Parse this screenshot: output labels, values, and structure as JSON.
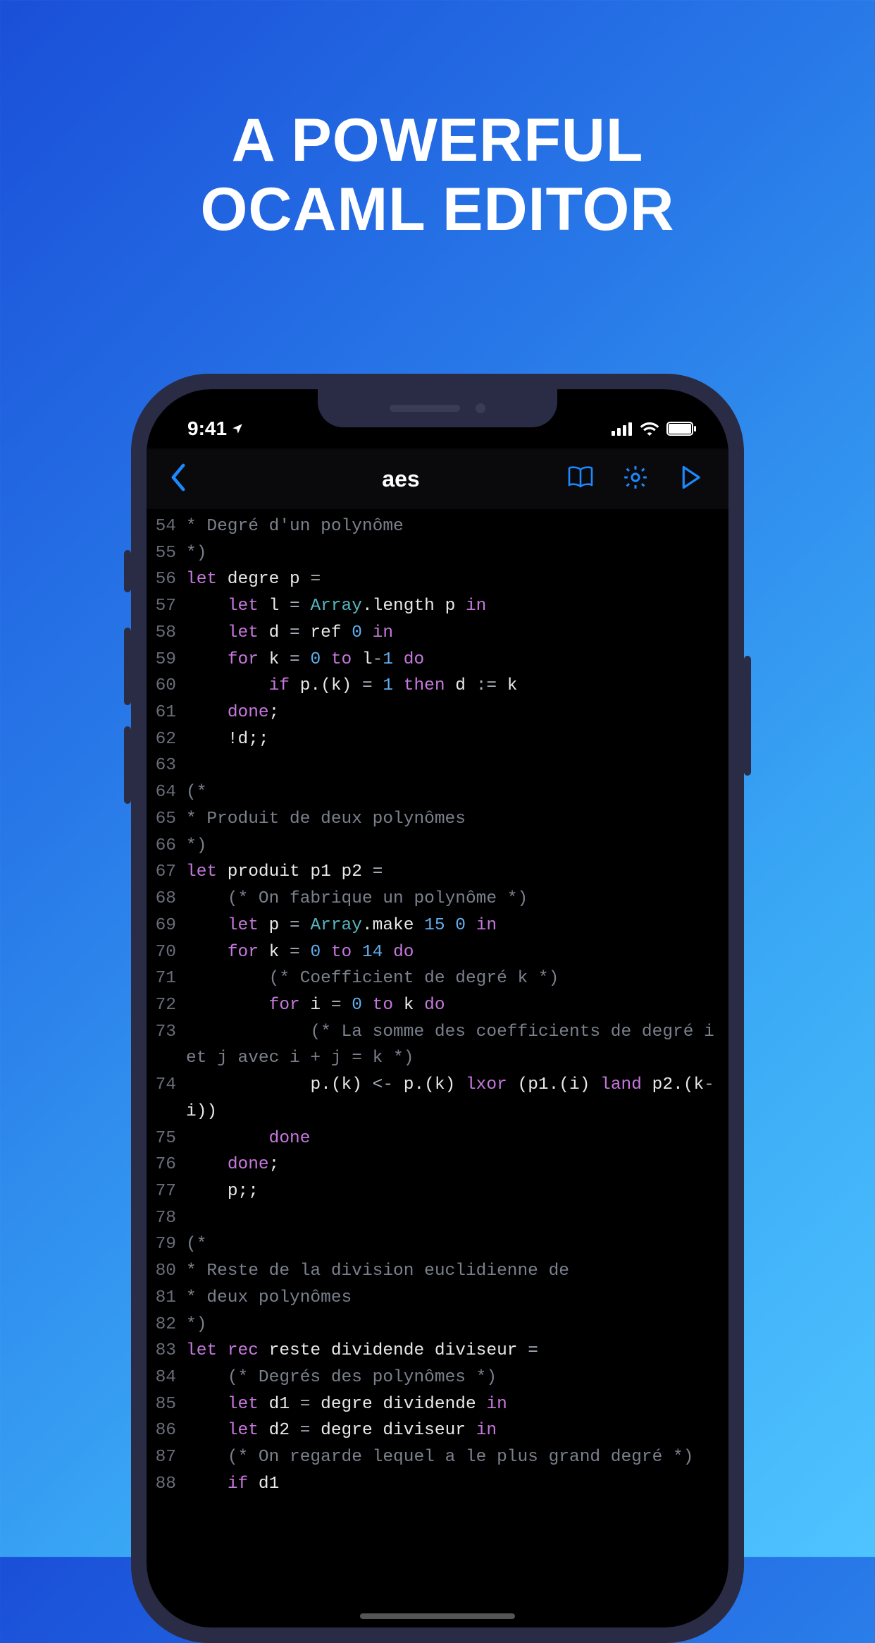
{
  "marketing": {
    "headline_line1": "A POWERFUL",
    "headline_line2": "OCAML EDITOR"
  },
  "status": {
    "time": "9:41",
    "location_icon": "location-arrow",
    "signal_icon": "cellular-signal",
    "wifi_icon": "wifi",
    "battery_icon": "battery-full"
  },
  "nav": {
    "back_icon": "chevron-left",
    "title": "aes",
    "book_icon": "book",
    "settings_icon": "gear",
    "run_icon": "play"
  },
  "code": {
    "lines": [
      {
        "n": 54,
        "tokens": [
          [
            "cm",
            "* Degré d'un polynôme"
          ]
        ]
      },
      {
        "n": 55,
        "tokens": [
          [
            "cm",
            "*)"
          ]
        ]
      },
      {
        "n": 56,
        "tokens": [
          [
            "kw",
            "let"
          ],
          [
            "id",
            " degre p "
          ],
          [
            "op",
            "="
          ]
        ]
      },
      {
        "n": 57,
        "tokens": [
          [
            "id",
            "    "
          ],
          [
            "kw",
            "let"
          ],
          [
            "id",
            " l "
          ],
          [
            "op",
            "="
          ],
          [
            "id",
            " "
          ],
          [
            "type",
            "Array"
          ],
          [
            "id",
            ".length p "
          ],
          [
            "kw",
            "in"
          ]
        ]
      },
      {
        "n": 58,
        "tokens": [
          [
            "id",
            "    "
          ],
          [
            "kw",
            "let"
          ],
          [
            "id",
            " d "
          ],
          [
            "op",
            "="
          ],
          [
            "id",
            " ref "
          ],
          [
            "num",
            "0"
          ],
          [
            "id",
            " "
          ],
          [
            "kw",
            "in"
          ]
        ]
      },
      {
        "n": 59,
        "tokens": [
          [
            "id",
            "    "
          ],
          [
            "kw",
            "for"
          ],
          [
            "id",
            " k "
          ],
          [
            "op",
            "="
          ],
          [
            "id",
            " "
          ],
          [
            "num",
            "0"
          ],
          [
            "id",
            " "
          ],
          [
            "kw",
            "to"
          ],
          [
            "id",
            " l"
          ],
          [
            "op",
            "-"
          ],
          [
            "num",
            "1"
          ],
          [
            "id",
            " "
          ],
          [
            "kw",
            "do"
          ]
        ]
      },
      {
        "n": 60,
        "tokens": [
          [
            "id",
            "        "
          ],
          [
            "kw",
            "if"
          ],
          [
            "id",
            " p.(k) "
          ],
          [
            "op",
            "="
          ],
          [
            "id",
            " "
          ],
          [
            "num",
            "1"
          ],
          [
            "id",
            " "
          ],
          [
            "kw",
            "then"
          ],
          [
            "id",
            " d "
          ],
          [
            "op",
            ":="
          ],
          [
            "id",
            " k"
          ]
        ]
      },
      {
        "n": 61,
        "tokens": [
          [
            "id",
            "    "
          ],
          [
            "kw",
            "done"
          ],
          [
            "id",
            ";"
          ]
        ]
      },
      {
        "n": 62,
        "tokens": [
          [
            "id",
            "    !d;;"
          ]
        ]
      },
      {
        "n": 63,
        "tokens": []
      },
      {
        "n": 64,
        "tokens": [
          [
            "cm",
            "(*"
          ]
        ]
      },
      {
        "n": 65,
        "tokens": [
          [
            "cm",
            "* Produit de deux polynômes"
          ]
        ]
      },
      {
        "n": 66,
        "tokens": [
          [
            "cm",
            "*)"
          ]
        ]
      },
      {
        "n": 67,
        "tokens": [
          [
            "kw",
            "let"
          ],
          [
            "id",
            " produit p1 p2 "
          ],
          [
            "op",
            "="
          ]
        ]
      },
      {
        "n": 68,
        "tokens": [
          [
            "id",
            "    "
          ],
          [
            "cm",
            "(* On fabrique un polynôme *)"
          ]
        ]
      },
      {
        "n": 69,
        "tokens": [
          [
            "id",
            "    "
          ],
          [
            "kw",
            "let"
          ],
          [
            "id",
            " p "
          ],
          [
            "op",
            "="
          ],
          [
            "id",
            " "
          ],
          [
            "type",
            "Array"
          ],
          [
            "id",
            ".make "
          ],
          [
            "num",
            "15"
          ],
          [
            "id",
            " "
          ],
          [
            "num",
            "0"
          ],
          [
            "id",
            " "
          ],
          [
            "kw",
            "in"
          ]
        ]
      },
      {
        "n": 70,
        "tokens": [
          [
            "id",
            "    "
          ],
          [
            "kw",
            "for"
          ],
          [
            "id",
            " k "
          ],
          [
            "op",
            "="
          ],
          [
            "id",
            " "
          ],
          [
            "num",
            "0"
          ],
          [
            "id",
            " "
          ],
          [
            "kw",
            "to"
          ],
          [
            "id",
            " "
          ],
          [
            "num",
            "14"
          ],
          [
            "id",
            " "
          ],
          [
            "kw",
            "do"
          ]
        ]
      },
      {
        "n": 71,
        "tokens": [
          [
            "id",
            "        "
          ],
          [
            "cm",
            "(* Coefficient de degré k *)"
          ]
        ]
      },
      {
        "n": 72,
        "tokens": [
          [
            "id",
            "        "
          ],
          [
            "kw",
            "for"
          ],
          [
            "id",
            " i "
          ],
          [
            "op",
            "="
          ],
          [
            "id",
            " "
          ],
          [
            "num",
            "0"
          ],
          [
            "id",
            " "
          ],
          [
            "kw",
            "to"
          ],
          [
            "id",
            " k "
          ],
          [
            "kw",
            "do"
          ]
        ]
      },
      {
        "n": 73,
        "tokens": [
          [
            "id",
            "            "
          ],
          [
            "cm",
            "(* La somme des coefficients de degré i et j avec i + j = k *)"
          ]
        ]
      },
      {
        "n": 74,
        "tokens": [
          [
            "id",
            "            p.(k) "
          ],
          [
            "op",
            "<-"
          ],
          [
            "id",
            " p.(k) "
          ],
          [
            "kw",
            "lxor"
          ],
          [
            "id",
            " (p1.(i) "
          ],
          [
            "kw",
            "land"
          ],
          [
            "id",
            " p2.(k"
          ],
          [
            "op",
            "-"
          ],
          [
            "id",
            "i))"
          ]
        ]
      },
      {
        "n": 75,
        "tokens": [
          [
            "id",
            "        "
          ],
          [
            "kw",
            "done"
          ]
        ]
      },
      {
        "n": 76,
        "tokens": [
          [
            "id",
            "    "
          ],
          [
            "kw",
            "done"
          ],
          [
            "id",
            ";"
          ]
        ]
      },
      {
        "n": 77,
        "tokens": [
          [
            "id",
            "    p;;"
          ]
        ]
      },
      {
        "n": 78,
        "tokens": []
      },
      {
        "n": 79,
        "tokens": [
          [
            "cm",
            "(*"
          ]
        ]
      },
      {
        "n": 80,
        "tokens": [
          [
            "cm",
            "* Reste de la division euclidienne de"
          ]
        ]
      },
      {
        "n": 81,
        "tokens": [
          [
            "cm",
            "* deux polynômes"
          ]
        ]
      },
      {
        "n": 82,
        "tokens": [
          [
            "cm",
            "*)"
          ]
        ]
      },
      {
        "n": 83,
        "tokens": [
          [
            "kw",
            "let"
          ],
          [
            "id",
            " "
          ],
          [
            "kw",
            "rec"
          ],
          [
            "id",
            " reste dividende diviseur "
          ],
          [
            "op",
            "="
          ]
        ]
      },
      {
        "n": 84,
        "tokens": [
          [
            "id",
            "    "
          ],
          [
            "cm",
            "(* Degrés des polynômes *)"
          ]
        ]
      },
      {
        "n": 85,
        "tokens": [
          [
            "id",
            "    "
          ],
          [
            "kw",
            "let"
          ],
          [
            "id",
            " d1 "
          ],
          [
            "op",
            "="
          ],
          [
            "id",
            " degre dividende "
          ],
          [
            "kw",
            "in"
          ]
        ]
      },
      {
        "n": 86,
        "tokens": [
          [
            "id",
            "    "
          ],
          [
            "kw",
            "let"
          ],
          [
            "id",
            " d2 "
          ],
          [
            "op",
            "="
          ],
          [
            "id",
            " degre diviseur "
          ],
          [
            "kw",
            "in"
          ]
        ]
      },
      {
        "n": 87,
        "tokens": [
          [
            "id",
            "    "
          ],
          [
            "cm",
            "(* On regarde lequel a le plus grand degré *)"
          ]
        ]
      },
      {
        "n": 88,
        "tokens": [
          [
            "id",
            "    "
          ],
          [
            "kw",
            "if"
          ],
          [
            "id",
            " d1"
          ]
        ]
      }
    ]
  }
}
